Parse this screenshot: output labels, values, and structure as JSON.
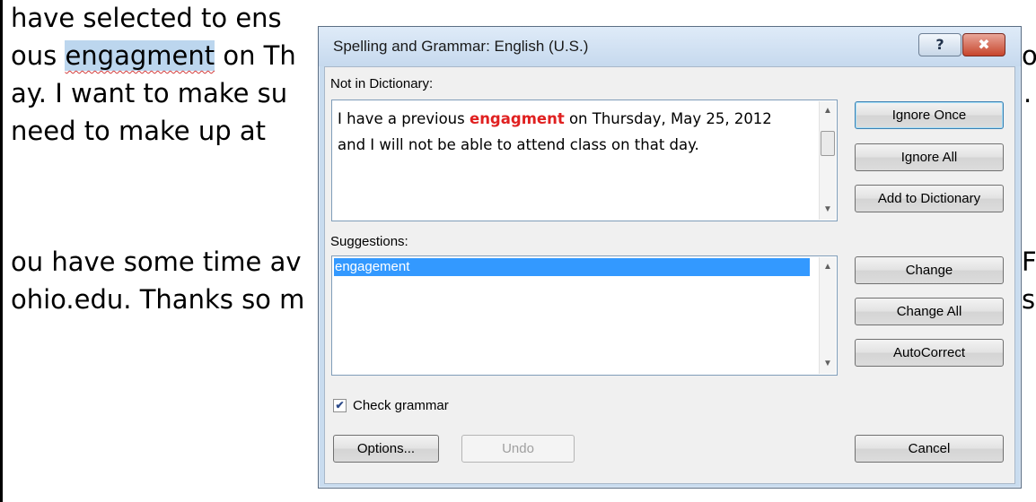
{
  "document": {
    "lines": [
      {
        "text": "have selected to ens"
      },
      {
        "before": "ous ",
        "selected": "engagment",
        "after": " on Th"
      },
      {
        "text": "ay.  I want to make su"
      },
      {
        "text": "need to make up at"
      },
      {
        "text": "ou have some time av"
      },
      {
        "text": "ohio.edu.  Thanks so m"
      }
    ],
    "right_fragments": [
      {
        "text": "o"
      },
      {
        "text": "."
      },
      {
        "text": "Fo"
      },
      {
        "text": "sp"
      }
    ]
  },
  "dialog": {
    "title": "Spelling and Grammar: English (U.S.)",
    "help_label": "?",
    "close_label": "✖",
    "not_in_dictionary_label": "Not in Dictionary:",
    "sentence": {
      "before": "I have a previous ",
      "error": "engagment",
      "after": " on Thursday, May 25, 2012 and I will not be able to attend class on that day."
    },
    "suggestions_label": "Suggestions:",
    "suggestions": [
      "engagement"
    ],
    "check_grammar_label": "Check grammar",
    "check_grammar_checked": true,
    "buttons": {
      "ignore_once": "Ignore Once",
      "ignore_all": "Ignore All",
      "add_to_dictionary": "Add to Dictionary",
      "change": "Change",
      "change_all": "Change All",
      "autocorrect": "AutoCorrect",
      "options": "Options...",
      "undo": "Undo",
      "cancel": "Cancel"
    },
    "scroll_up_glyph": "▲",
    "scroll_down_glyph": "▼",
    "check_glyph": "✔"
  }
}
